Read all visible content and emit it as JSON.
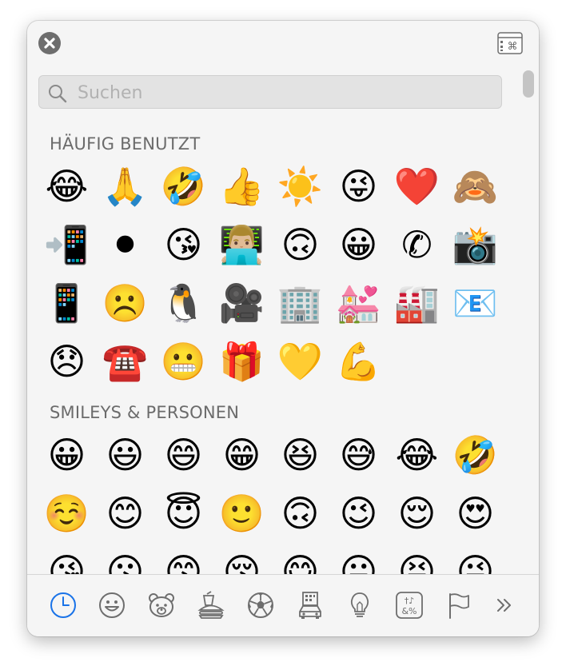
{
  "search": {
    "placeholder": "Suchen",
    "value": ""
  },
  "sections": {
    "frequent": {
      "title": "HÄUFIG BENUTZT",
      "emojis": [
        "😂",
        "🙏",
        "🤣",
        "👍",
        "☀️",
        "😜",
        "❤️",
        "🙈",
        "📲",
        "⚫",
        "😘",
        "👨🏼‍💻",
        "🙃",
        "😀",
        "✆",
        "📸",
        "📱",
        "☹️",
        "🐧",
        "🎥",
        "🏢",
        "💒",
        "🏭",
        "📧",
        "😞",
        "☎️",
        "😬",
        "🎁",
        "💛",
        "💪"
      ]
    },
    "smileys": {
      "title": "SMILEYS & PERSONEN",
      "emojis": [
        "😀",
        "😃",
        "😄",
        "😁",
        "😆",
        "😅",
        "😂",
        "🤣",
        "☺️",
        "😊",
        "😇",
        "🙂",
        "🙃",
        "😉",
        "😌",
        "😍",
        "😘",
        "😗",
        "😙",
        "😚",
        "😋",
        "😛",
        "😝",
        "😜"
      ]
    }
  },
  "colors": {
    "accent": "#1a73e8",
    "icon": "#6e6e6e",
    "section_title": "#6b6b6b",
    "window_bg": "#f5f5f5"
  },
  "footer": {
    "categories": [
      {
        "name": "clock-icon",
        "active": true
      },
      {
        "name": "smiley-face-icon",
        "active": false
      },
      {
        "name": "bear-face-icon",
        "active": false
      },
      {
        "name": "burger-drink-icon",
        "active": false
      },
      {
        "name": "soccer-ball-icon",
        "active": false
      },
      {
        "name": "car-building-icon",
        "active": false
      },
      {
        "name": "light-bulb-icon",
        "active": false
      },
      {
        "name": "symbols-icon",
        "active": false
      },
      {
        "name": "flag-icon",
        "active": false
      },
      {
        "name": "double-chevron-right-icon",
        "active": false
      }
    ],
    "symbols_icon_text": [
      "†♪",
      "&%"
    ]
  }
}
